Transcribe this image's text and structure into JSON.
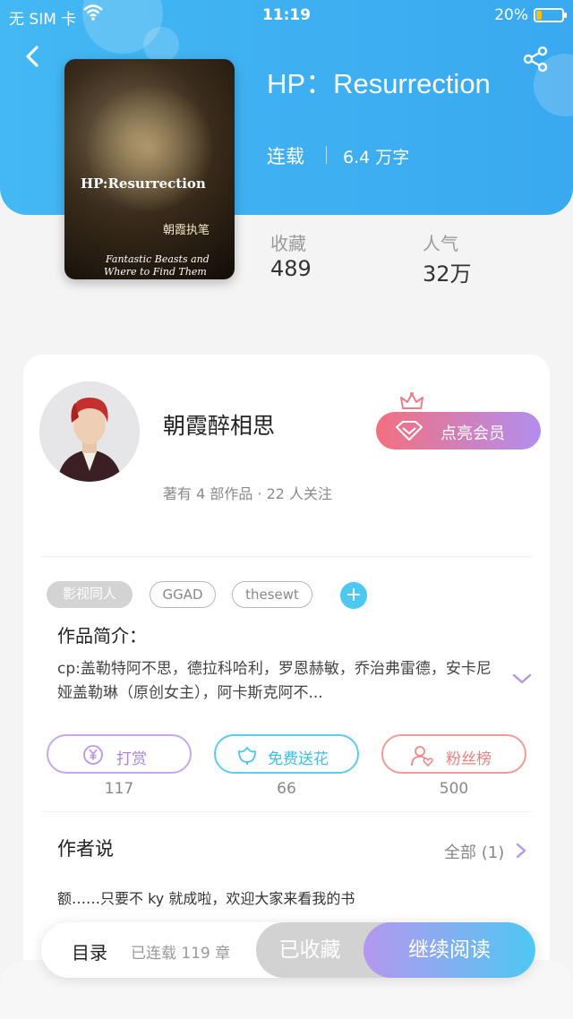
{
  "status_bar": {
    "carrier": "无 SIM 卡",
    "time": "11:19",
    "battery": "20%",
    "battery_level": 0.2
  },
  "book": {
    "title": "HP：Resurrection",
    "status": "连载",
    "word_count": "6.4 万字",
    "cover": {
      "title": "HP:Resurrection",
      "author_sig": "朝霞执笔",
      "subtitle_line1": "Fantastic Beasts and",
      "subtitle_line2": "Where to Find Them"
    },
    "stats": [
      {
        "label": "收藏",
        "value": "489"
      },
      {
        "label": "人气",
        "value": "32万"
      }
    ]
  },
  "author": {
    "name": "朝霞醉相思",
    "meta": "著有 4 部作品 · 22 人关注",
    "vip_label": "点亮会员"
  },
  "tags": [
    "影视同人",
    "GGAD",
    "thesewt"
  ],
  "intro": {
    "heading": "作品简介：",
    "text": "cp:盖勒特阿不思，德拉科哈利，罗恩赫敏，乔治弗雷德，安卡尼娅盖勒琳（原创女主），阿卡斯克阿不..."
  },
  "actions": [
    {
      "label": "打赏",
      "count": "117",
      "color": "#b896e8"
    },
    {
      "label": "免费送花",
      "count": "66",
      "color": "#4cc6ec"
    },
    {
      "label": "粉丝榜",
      "count": "500",
      "color": "#f08a8a"
    }
  ],
  "author_says": {
    "heading": "作者说",
    "all_label": "全部 (1)",
    "text": "额……只要不 ky 就成啦，欢迎大家来看我的书"
  },
  "bottom_bar": {
    "toc_label": "目录",
    "toc_count": "已连载 119 章",
    "collected_label": "已收藏",
    "read_label": "继续阅读"
  },
  "icons": [
    "back-icon",
    "share-icon",
    "wifi-icon",
    "crown-icon",
    "diamond-icon",
    "add-icon",
    "expand-icon",
    "yen-icon",
    "flower-icon",
    "fan-icon",
    "chevron-right-icon"
  ]
}
